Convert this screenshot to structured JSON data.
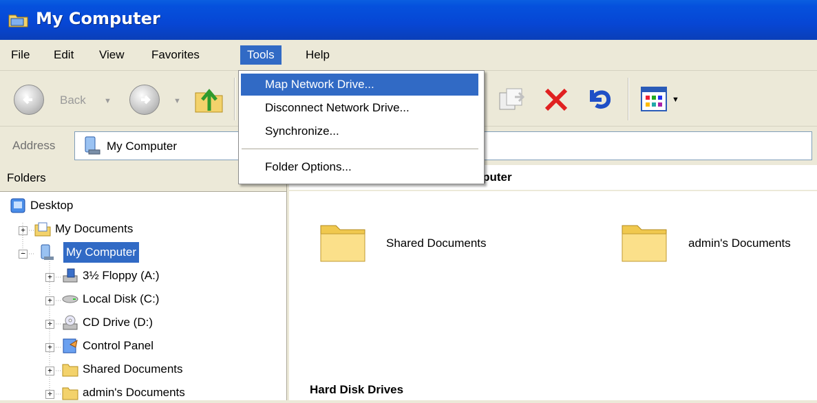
{
  "window": {
    "title": "My Computer"
  },
  "menubar": {
    "items": [
      {
        "label": "File"
      },
      {
        "label": "Edit"
      },
      {
        "label": "View"
      },
      {
        "label": "Favorites"
      },
      {
        "label": "Tools"
      },
      {
        "label": "Help"
      }
    ]
  },
  "tools_menu": {
    "items": [
      {
        "label": "Map Network Drive..."
      },
      {
        "label": "Disconnect Network Drive..."
      },
      {
        "label": "Synchronize..."
      },
      {
        "label": "Folder Options..."
      }
    ]
  },
  "toolbar": {
    "back_label": "Back"
  },
  "address": {
    "label": "Address",
    "value": "My Computer"
  },
  "folders_pane": {
    "header": "Folders",
    "tree": [
      {
        "label": "Desktop"
      },
      {
        "label": "My Documents"
      },
      {
        "label": "My Computer"
      },
      {
        "label": "3½ Floppy (A:)"
      },
      {
        "label": "Local Disk (C:)"
      },
      {
        "label": "CD Drive (D:)"
      },
      {
        "label": "Control Panel"
      },
      {
        "label": "Shared Documents"
      },
      {
        "label": "admin's Documents"
      }
    ]
  },
  "content": {
    "section1_title": "mputer",
    "folders": [
      {
        "label": "Shared Documents"
      },
      {
        "label": "admin's Documents"
      }
    ],
    "section2_title": "Hard Disk Drives"
  },
  "colors": {
    "titlebar": "#0551dd",
    "selection": "#316ac5",
    "chrome": "#ece9d8"
  }
}
